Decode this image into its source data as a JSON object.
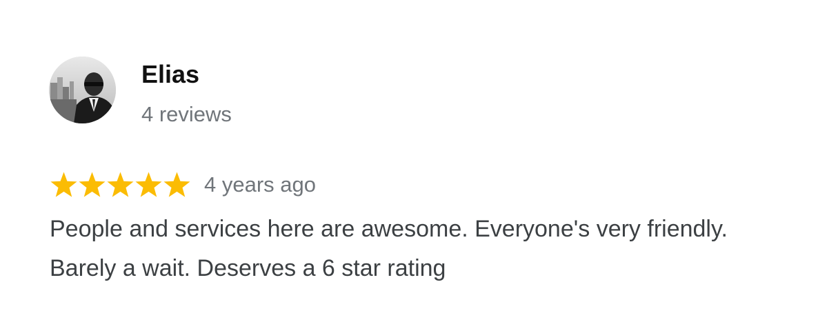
{
  "review": {
    "author": "Elias",
    "review_count": "4 reviews",
    "avatar_icon": "profile-photo",
    "rating": 5,
    "rating_max": 5,
    "star_color": "#fbbc04",
    "time": "4 years ago",
    "text": "People and services here are awesome. Everyone's very friendly. Barely a wait. Deserves a 6 star rating"
  }
}
